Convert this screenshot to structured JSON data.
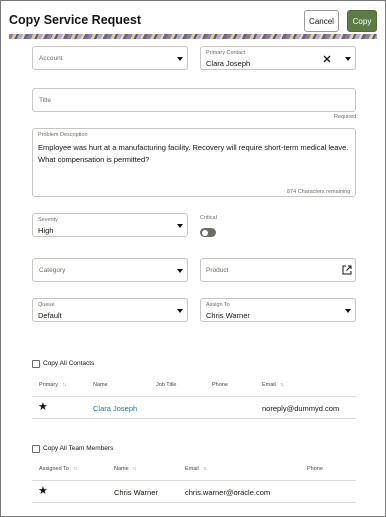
{
  "header": {
    "title": "Copy Service Request",
    "cancel_label": "Cancel",
    "copy_label": "Copy"
  },
  "form": {
    "account": {
      "placeholder": "Account"
    },
    "primary_contact": {
      "label": "Primary Contact",
      "value": "Clara Joseph"
    },
    "title": {
      "placeholder": "Title",
      "required_text": "Required"
    },
    "problem_description": {
      "label": "Problem Description",
      "value": "Employee was hurt at a manufacturing facility. Recovery will require short-term medical leave. What compensation is permitted?",
      "chars_remaining": "874 Characters remaining"
    },
    "severity": {
      "label": "Severity",
      "value": "High"
    },
    "critical": {
      "label": "Critical",
      "on": false
    },
    "category": {
      "placeholder": "Category"
    },
    "product": {
      "placeholder": "Product"
    },
    "queue": {
      "label": "Queue",
      "value": "Default"
    },
    "assign_to": {
      "label": "Assign To",
      "value": "Chris Warner"
    }
  },
  "contacts": {
    "checkbox_label": "Copy All Contacts",
    "columns": [
      "Primary",
      "Name",
      "Job Title",
      "Phone",
      "Email"
    ],
    "rows": [
      {
        "primary": true,
        "name": "Clara Joseph",
        "job_title": "",
        "phone": "",
        "email": "noreply@dummyd.com"
      }
    ]
  },
  "team_members": {
    "checkbox_label": "Copy All Team Members",
    "columns": [
      "Assigned To",
      "Name",
      "Email",
      "Phone"
    ],
    "rows": [
      {
        "assigned": true,
        "name": "Chris Warner",
        "email": "chris.warner@oracle.com",
        "phone": ""
      }
    ]
  },
  "icons": {
    "clear": "close-icon",
    "dropdown": "chevron-down-icon",
    "open": "open-external-icon",
    "sort": "sort-arrows-icon",
    "star": "star-icon"
  },
  "colors": {
    "accent": "#5d7a47",
    "link": "#227c9d"
  }
}
